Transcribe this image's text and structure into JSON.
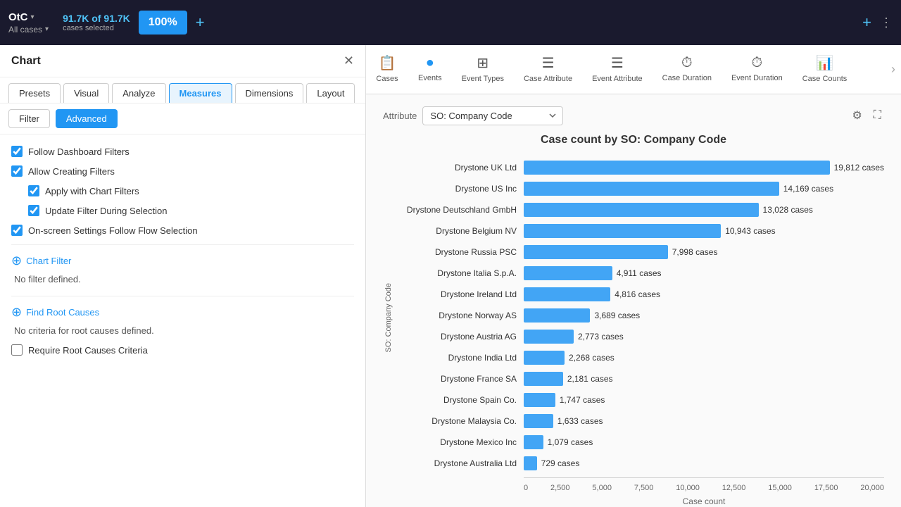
{
  "topbar": {
    "process": "OtC",
    "all_cases": "All cases",
    "cases_count": "91.7K of 91.7K",
    "cases_label": "cases selected",
    "percent": "100%"
  },
  "panel": {
    "title": "Chart",
    "tabs": [
      "Presets",
      "Visual",
      "Analyze",
      "Measures",
      "Dimensions",
      "Layout"
    ],
    "active_tab": "Measures",
    "subtabs": [
      "Filter",
      "Advanced"
    ],
    "active_subtab": "Advanced",
    "checkboxes": [
      {
        "label": "Follow Dashboard Filters",
        "checked": true,
        "nested": false
      },
      {
        "label": "Allow Creating Filters",
        "checked": true,
        "nested": false
      },
      {
        "label": "Apply with Chart Filters",
        "checked": true,
        "nested": true
      },
      {
        "label": "Update Filter During Selection",
        "checked": true,
        "nested": true
      },
      {
        "label": "On-screen Settings Follow Flow Selection",
        "checked": true,
        "nested": false
      }
    ],
    "chart_filter_label": "Chart Filter",
    "no_filter": "No filter defined.",
    "find_root_causes_label": "Find Root Causes",
    "no_criteria": "No criteria for root causes defined.",
    "require_root_causes": {
      "label": "Require Root Causes Criteria",
      "checked": false
    }
  },
  "nav": {
    "items": [
      {
        "id": "cases",
        "label": "Cases",
        "icon": "📋"
      },
      {
        "id": "events",
        "label": "Events",
        "icon": "⬤"
      },
      {
        "id": "event-types",
        "label": "Event Types",
        "icon": "⊞"
      },
      {
        "id": "case-attribute",
        "label": "Case Attribute",
        "icon": "☰"
      },
      {
        "id": "event-attribute",
        "label": "Event Attribute",
        "icon": "☰"
      },
      {
        "id": "case-duration",
        "label": "Case Duration",
        "icon": "⏱"
      },
      {
        "id": "event-duration",
        "label": "Event Duration",
        "icon": "⏱"
      },
      {
        "id": "case-counts",
        "label": "Case Counts",
        "icon": "📊"
      }
    ]
  },
  "chart": {
    "attribute_label": "Attribute",
    "attribute_value": "SO: Company Code",
    "title": "Case count by SO: Company Code",
    "y_axis_label": "SO: Company Code",
    "x_axis_label": "Case count",
    "x_ticks": [
      "0",
      "2,500",
      "5,000",
      "7,500",
      "10,000",
      "12,500",
      "15,000",
      "17,500",
      "20,000"
    ],
    "max_value": 20000,
    "bars": [
      {
        "label": "Drystone UK Ltd",
        "value": 19812,
        "display": "19,812 cases"
      },
      {
        "label": "Drystone US Inc",
        "value": 14169,
        "display": "14,169 cases"
      },
      {
        "label": "Drystone Deutschland GmbH",
        "value": 13028,
        "display": "13,028 cases"
      },
      {
        "label": "Drystone Belgium NV",
        "value": 10945,
        "display": "10,943 cases"
      },
      {
        "label": "Drystone Russia PSC",
        "value": 7998,
        "display": "7,998 cases"
      },
      {
        "label": "Drystone Italia S.p.A.",
        "value": 4911,
        "display": "4,911 cases"
      },
      {
        "label": "Drystone Ireland Ltd",
        "value": 4816,
        "display": "4,816 cases"
      },
      {
        "label": "Drystone Norway AS",
        "value": 3689,
        "display": "3,689 cases"
      },
      {
        "label": "Drystone Austria AG",
        "value": 2773,
        "display": "2,773 cases"
      },
      {
        "label": "Drystone India Ltd",
        "value": 2268,
        "display": "2,268 cases"
      },
      {
        "label": "Drystone France SA",
        "value": 2181,
        "display": "2,181 cases"
      },
      {
        "label": "Drystone Spain Co.",
        "value": 1747,
        "display": "1,747 cases"
      },
      {
        "label": "Drystone Malaysia Co.",
        "value": 1633,
        "display": "1,633 cases"
      },
      {
        "label": "Drystone Mexico Inc",
        "value": 1079,
        "display": "1,079 cases"
      },
      {
        "label": "Drystone Australia Ltd",
        "value": 729,
        "display": "729 cases"
      }
    ]
  }
}
